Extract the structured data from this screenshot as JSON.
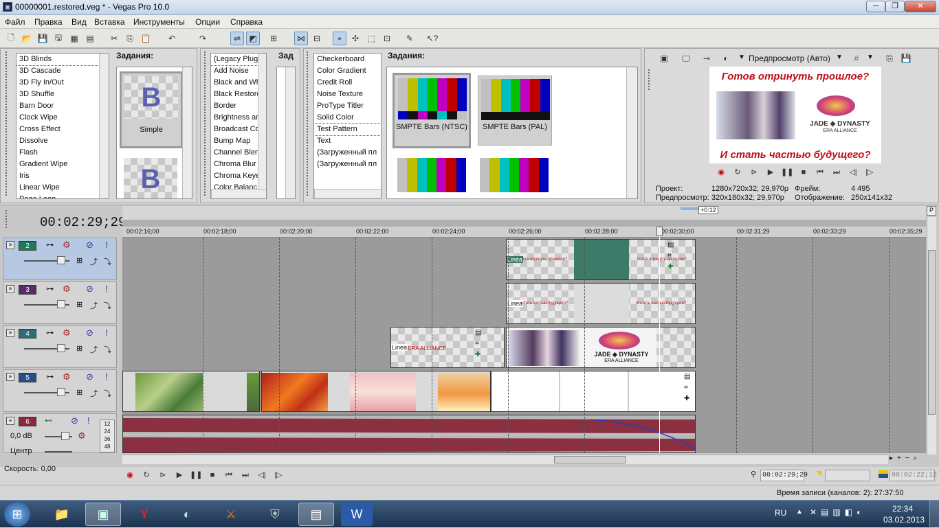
{
  "window": {
    "title": "00000001.restored.veg * - Vegas Pro 10.0",
    "minimize": "─",
    "maximize": "❐",
    "close": "✕"
  },
  "menu": [
    "Файл",
    "Правка",
    "Вид",
    "Вставка",
    "Инструменты",
    "Опции",
    "Справка"
  ],
  "transitions": {
    "items": [
      "3D Blinds",
      "3D Cascade",
      "3D Fly In/Out",
      "3D Shuffle",
      "Barn Door",
      "Clock Wipe",
      "Cross Effect",
      "Dissolve",
      "Flash",
      "Gradient Wipe",
      "Iris",
      "Linear Wipe",
      "Page Loop"
    ],
    "header": "Задания:",
    "presets": [
      "Simple"
    ]
  },
  "fx": {
    "items": [
      "(Legacy Plug",
      "Add Noise",
      "Black and Wh",
      "Black Restore",
      "Border",
      "Brightness ar",
      "Broadcast Co",
      "Bump Map",
      "Channel Blen",
      "Chroma Blur",
      "Chroma Keye",
      "Color Balanc"
    ],
    "header": "Зад"
  },
  "generators": {
    "items": [
      "Checkerboard",
      "Color Gradient",
      "Credit Roll",
      "Noise Texture",
      "ProType Titler",
      "Solid Color",
      "Test Pattern",
      "Text",
      "(Загруженный пл",
      "(Загруженный пл"
    ],
    "header": "Задания:",
    "presets": [
      "SMPTE Bars (NTSC)",
      "SMPTE Bars (PAL)"
    ]
  },
  "colors": {
    "ntsc": [
      "#c0c0c0",
      "#c0c000",
      "#00c0c0",
      "#00c000",
      "#c000c0",
      "#c00000",
      "#0000c0"
    ],
    "ntsc_bottom": [
      "#0000c0",
      "#111111",
      "#c000c0",
      "#111111",
      "#00c0c0",
      "#111111",
      "#c0c0c0"
    ],
    "pal": [
      "#c0c0c0",
      "#c0c000",
      "#00c0c0",
      "#00c000",
      "#c000c0",
      "#c00000",
      "#0000c0"
    ]
  },
  "preview": {
    "mode": "Предпросмотр (Авто)",
    "top_text": "Готов отринуть прошлое?",
    "bottom_text": "И стать частью будущего?",
    "logo_line1": "JADE ◈ DYNASTY",
    "logo_line2": "ERA ALLIANCE",
    "project_label": "Проект:",
    "project_value": "1280x720x32; 29,970p",
    "preview_label": "Предпросмотр:",
    "preview_value": "320x180x32; 29,970p",
    "frame_label": "Фрейм:",
    "frame_value": "4 495",
    "display_label": "Отображение:",
    "display_value": "250x141x32"
  },
  "timeline": {
    "timecode": "00:02:29;29",
    "marker": "+0:12",
    "ticks": [
      "00:02:16;00",
      "00:02:18;00",
      "00:02:20;00",
      "00:02:22;00",
      "00:02:24;00",
      "00:02:26;00",
      "00:02:28;00",
      "00:02:30;00",
      "00:02:31;29",
      "00:02:33;29",
      "00:02:35;29"
    ]
  },
  "tracks": [
    {
      "num": "2",
      "color": "#1e7a5a"
    },
    {
      "num": "3",
      "color": "#5a2a6e"
    },
    {
      "num": "4",
      "color": "#2c6e78"
    },
    {
      "num": "5",
      "color": "#2a4e8a"
    },
    {
      "num": "6",
      "color": "#8a2a3a"
    }
  ],
  "audio": {
    "volume": "0,0 dB",
    "pan": "Центр",
    "meters": [
      "12",
      "24",
      "36",
      "48"
    ]
  },
  "clips": {
    "t2a": "Linea",
    "t2b": "ова отринуть прошлое?",
    "t2c": "Готов отринуть прошлое?",
    "t3a": "Linea",
    "t3b": "стать частью будущего?",
    "t3c": "И стать частью будущего?",
    "t4a": "Linea",
    "t4b": "ERA ALLIANCE",
    "t4c": "JADE ◈ DYNASTY",
    "t4d": "ERA ALLIANCE"
  },
  "status": {
    "speed": "Скорость: 0,00",
    "cursor_time": "00:02:29;29",
    "selection_time": "00:02:22;12",
    "record_time": "Время записи (каналов: 2): 27:37:50"
  },
  "taskbar": {
    "lang": "RU",
    "time": "22:34",
    "date": "03.02.2013"
  }
}
